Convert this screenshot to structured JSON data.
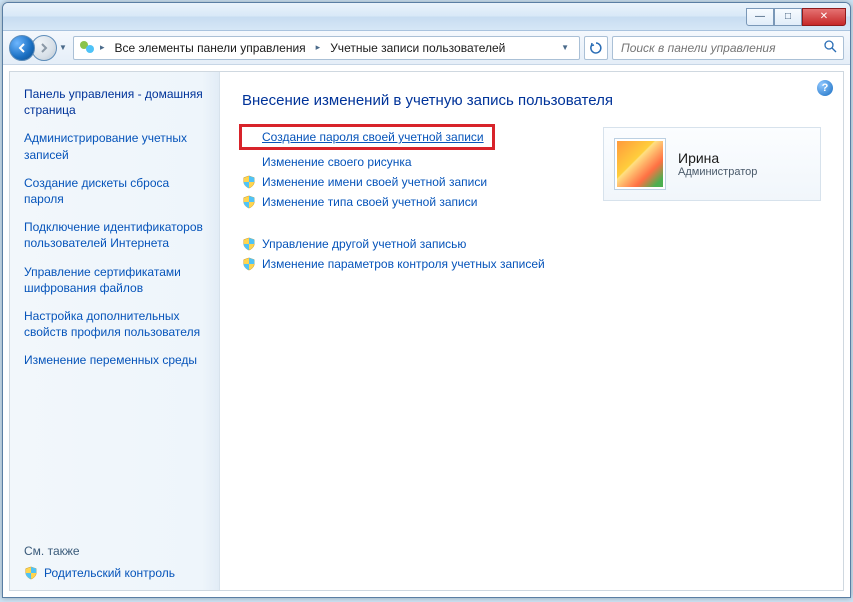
{
  "titlebar": {
    "minimize": "—",
    "maximize": "□",
    "close": "✕"
  },
  "breadcrumb": {
    "seg1": "Все элементы панели управления",
    "seg2": "Учетные записи пользователей"
  },
  "search": {
    "placeholder": "Поиск в панели управления"
  },
  "sidebar": {
    "home": "Панель управления - домашняя страница",
    "links": [
      "Администрирование учетных записей",
      "Создание дискеты сброса пароля",
      "Подключение идентификаторов пользователей Интернета",
      "Управление сертификатами шифрования файлов",
      "Настройка дополнительных свойств профиля пользователя",
      "Изменение переменных среды"
    ],
    "see_also": "См. также",
    "parental": "Родительский контроль"
  },
  "main": {
    "title": "Внесение изменений в учетную запись пользователя",
    "actions1": [
      {
        "label": "Создание пароля своей учетной записи",
        "shield": false,
        "highlight": true
      },
      {
        "label": "Изменение своего рисунка",
        "shield": false
      },
      {
        "label": "Изменение имени своей учетной записи",
        "shield": true
      },
      {
        "label": "Изменение типа своей учетной записи",
        "shield": true
      }
    ],
    "actions2": [
      {
        "label": "Управление другой учетной записью",
        "shield": true
      },
      {
        "label": "Изменение параметров контроля учетных записей",
        "shield": true
      }
    ],
    "user": {
      "name": "Ирина",
      "role": "Администратор"
    }
  }
}
